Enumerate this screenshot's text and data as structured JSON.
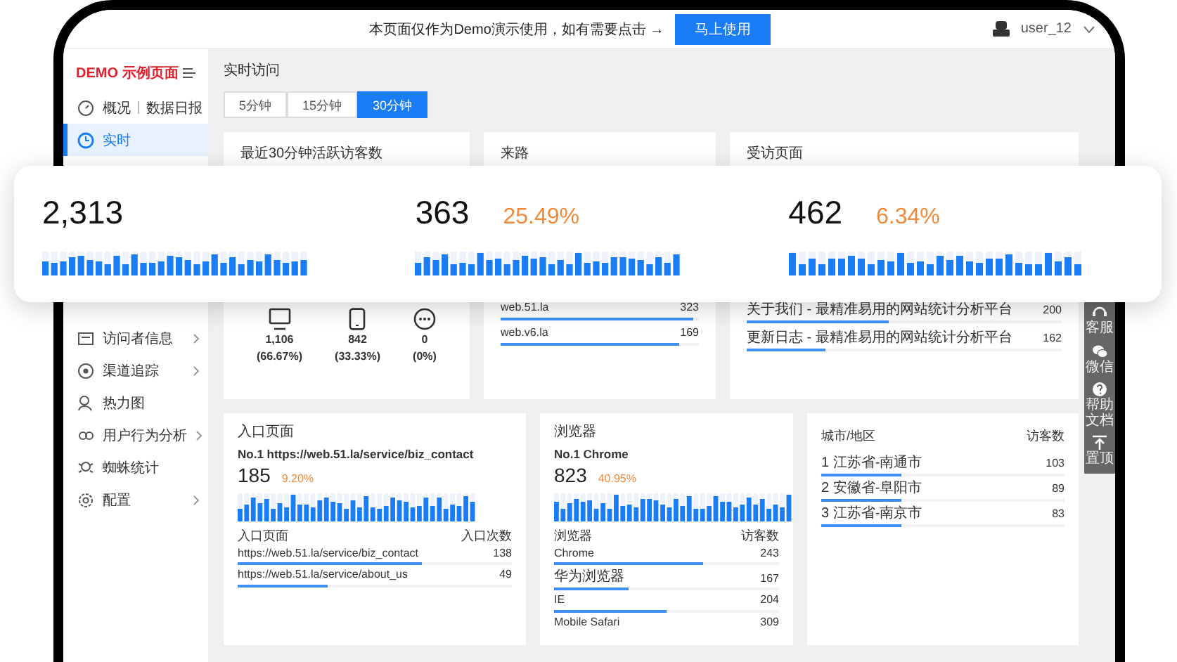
{
  "topbar": {
    "notice": "本页面仅作为Demo演示使用，如有需要点击 →",
    "button": "马上使用",
    "user": "user_12"
  },
  "sidebar": {
    "logo": "DEMO 示例页面",
    "items": [
      {
        "label": "概况",
        "label_2": "数据日报",
        "selected": false,
        "expandable": false
      },
      {
        "label": "实时",
        "selected": true,
        "expandable": false
      },
      {
        "label": "访问者信息",
        "selected": false,
        "expandable": true
      },
      {
        "label": "渠道追踪",
        "selected": false,
        "expandable": true
      },
      {
        "label": "热力图",
        "selected": false,
        "expandable": false
      },
      {
        "label": "用户行为分析",
        "selected": false,
        "expandable": true
      },
      {
        "label": "蜘蛛统计",
        "selected": false,
        "expandable": false
      },
      {
        "label": "配置",
        "selected": false,
        "expandable": true
      }
    ]
  },
  "main": {
    "title": "实时访问",
    "tabs": [
      {
        "label": "5分钟",
        "selected": false
      },
      {
        "label": "15分钟",
        "selected": false
      },
      {
        "label": "30分钟",
        "selected": true
      }
    ],
    "cards": [
      {
        "kind": "devices",
        "title": "最近30分钟活跃访客数",
        "devices": [
          {
            "count": "1,106",
            "share": "(66.67%)"
          },
          {
            "count": "842",
            "share": "(33.33%)"
          },
          {
            "count": "0",
            "share": "(0%)"
          }
        ]
      },
      {
        "kind": "list",
        "title": "来路",
        "rows": [
          {
            "label": "web.51.la",
            "value": "323",
            "level": 0.97
          },
          {
            "label": "web.v6.la",
            "value": "169",
            "level": 0.9
          }
        ]
      },
      {
        "kind": "list",
        "title": "受访页面",
        "rows": [
          {
            "label": "关于我们 - 最精准易用的网站统计分析平台",
            "value": "200",
            "level": 0.45
          },
          {
            "label": "更新日志 - 最精准易用的网站统计分析平台",
            "value": "162",
            "level": 0.25
          }
        ]
      },
      {
        "kind": "top",
        "title": "入口页面",
        "top": "No.1 https://web.51.la/service/biz_contact",
        "value": "185",
        "percent": "9.20%",
        "columns": [
          "入口页面",
          "入口次数"
        ],
        "rows": [
          {
            "label": "https://web.51.la/service/biz_contact",
            "value": "138",
            "level": 0.67
          },
          {
            "label": "https://web.51.la/service/about_us",
            "value": "49",
            "level": 0.33
          }
        ]
      },
      {
        "kind": "top",
        "title": "浏览器",
        "top": "No.1 Chrome",
        "value": "823",
        "percent": "40.95%",
        "columns": [
          "浏览器",
          "访客数"
        ],
        "rows": [
          {
            "label": "Chrome",
            "value": "243",
            "level": 0.66
          },
          {
            "label": "华为浏览器",
            "value": "167",
            "level": 0.33
          },
          {
            "label": "IE",
            "value": "204",
            "level": 0.5
          },
          {
            "label": "Mobile Safari",
            "value": "309"
          }
        ]
      },
      {
        "kind": "table",
        "columns": [
          "城市/地区",
          "访客数"
        ],
        "rows": [
          {
            "label": "1 江苏省-南通市",
            "value": "103",
            "level": 0.33
          },
          {
            "label": "2 安徽省-阜阳市",
            "value": "89",
            "level": 0.33
          },
          {
            "label": "3 江苏省-南京市",
            "value": "83",
            "level": 0.33
          }
        ]
      }
    ]
  },
  "overlay": {
    "stats": [
      {
        "value": "2,313"
      },
      {
        "value": "363",
        "percent": "25.49%"
      },
      {
        "value": "462",
        "percent": "6.34%"
      }
    ]
  },
  "toolbar": {
    "items": [
      "客服",
      "微信",
      "帮助文档",
      "置顶"
    ]
  }
}
